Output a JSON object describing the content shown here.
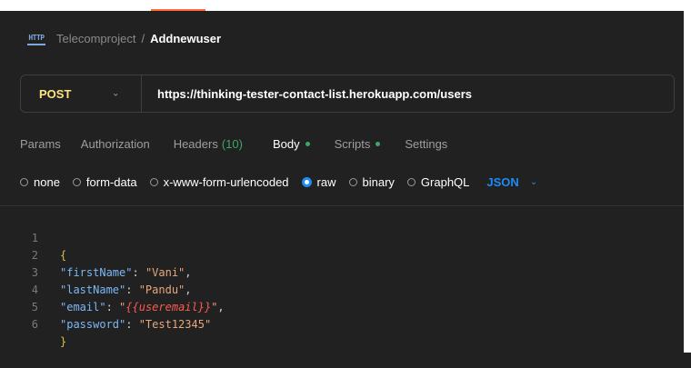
{
  "header": {
    "breadcrumb_parent": "Telecomproject",
    "breadcrumb_separator": "/",
    "breadcrumb_current": "Addnewuser",
    "icon": "http-request-icon",
    "icon_label": "HTTP"
  },
  "request": {
    "method": "POST",
    "url": "https://thinking-tester-contact-list.herokuapp.com/users"
  },
  "tabs": [
    {
      "label": "Params"
    },
    {
      "label": "Authorization"
    },
    {
      "label": "Headers",
      "count": "(10)"
    },
    {
      "label": "Body",
      "active": true,
      "dot": true
    },
    {
      "label": "Scripts",
      "dot": true
    },
    {
      "label": "Settings"
    }
  ],
  "body_types": [
    {
      "label": "none",
      "checked": false
    },
    {
      "label": "form-data",
      "checked": false
    },
    {
      "label": "x-www-form-urlencoded",
      "checked": false
    },
    {
      "label": "raw",
      "checked": true
    },
    {
      "label": "binary",
      "checked": false
    },
    {
      "label": "GraphQL",
      "checked": false
    }
  ],
  "format": {
    "selected": "JSON"
  },
  "editor": {
    "line_numbers": [
      "1",
      "2",
      "3",
      "4",
      "5",
      "6"
    ],
    "lines": [
      {
        "open": "{"
      },
      {
        "key": "\"firstName\"",
        "sep": ": ",
        "value": "\"Vani\"",
        "end": ","
      },
      {
        "key": "\"lastName\"",
        "sep": ": ",
        "value": "\"Pandu\"",
        "end": ","
      },
      {
        "key": "\"email\"",
        "sep": ": ",
        "value_open": "\"",
        "variable": "{{useremail}}",
        "value_close": "\"",
        "end": ","
      },
      {
        "key": "\"password\"",
        "sep": ": ",
        "value": "\"Test12345\"",
        "end": ""
      },
      {
        "close": "}"
      }
    ]
  },
  "colors": {
    "background": "#212121",
    "method": "#ffe47e",
    "accent_blue": "#1d8cf8",
    "active_green": "#3fa66b",
    "json_key": "#7cb8f5",
    "json_string": "#e7a77c",
    "variable": "#ff5a4e"
  }
}
